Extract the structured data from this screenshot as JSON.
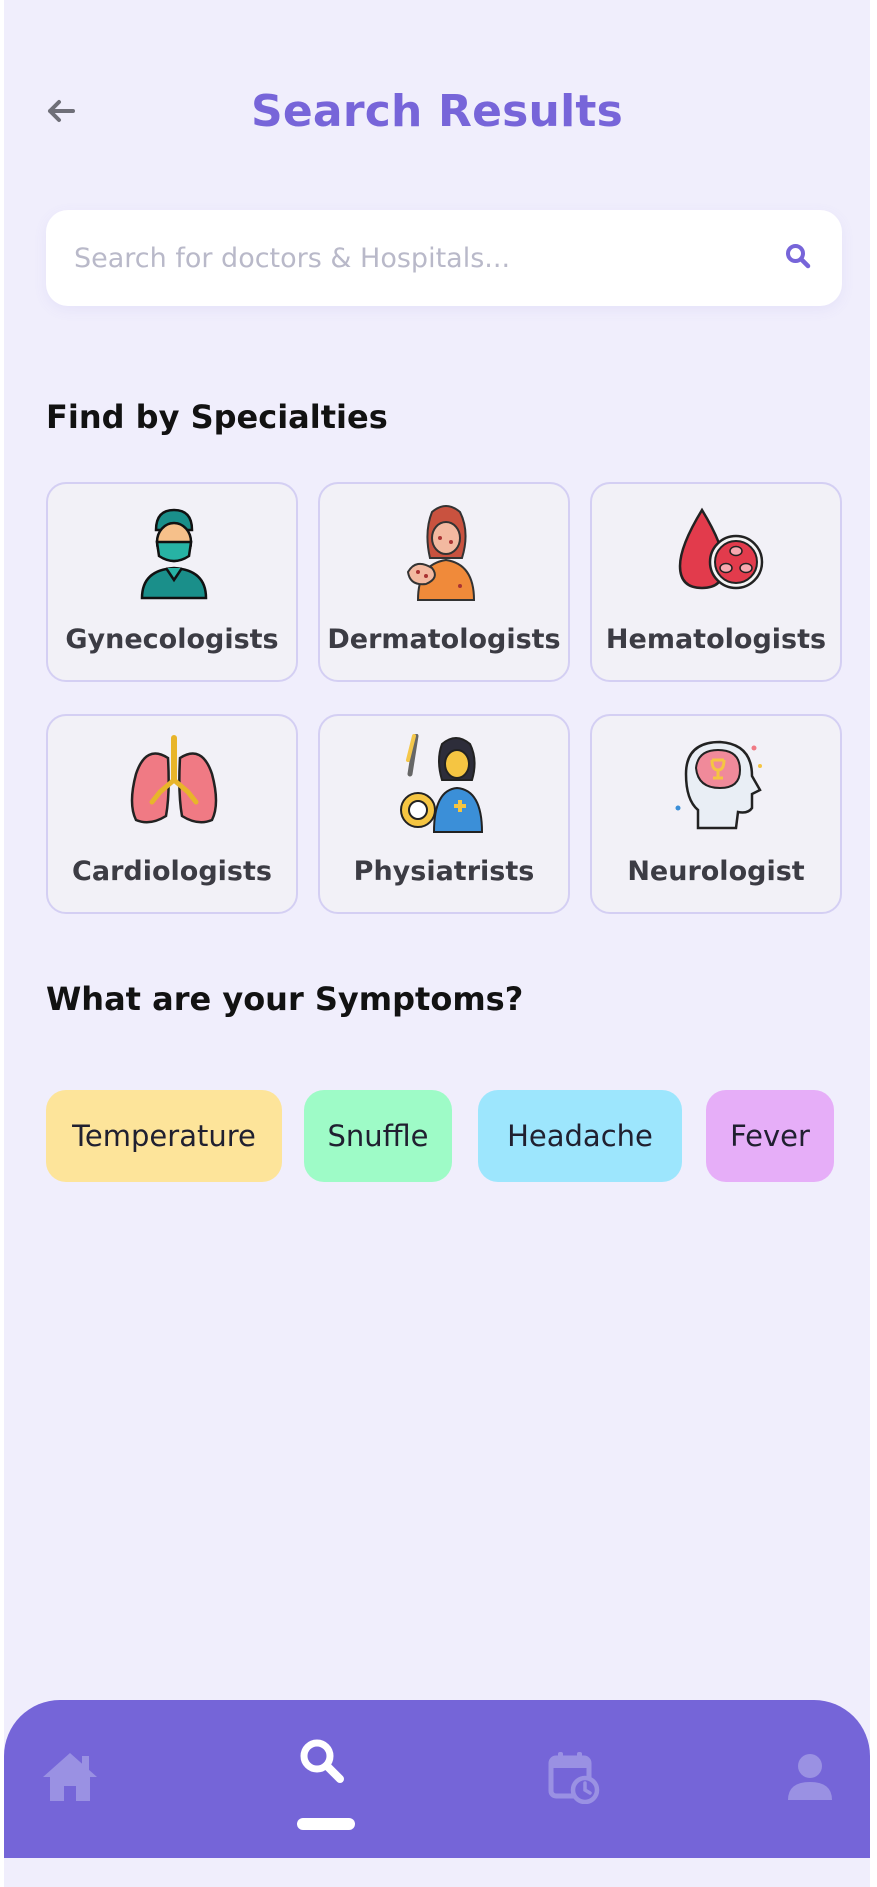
{
  "header": {
    "title": "Search Results",
    "back_icon": "arrow-left-icon"
  },
  "search": {
    "placeholder": "Search for doctors & Hospitals...",
    "icon": "search-icon"
  },
  "specialties": {
    "title": "Find by Specialties",
    "items": [
      {
        "label": "Gynecologists",
        "icon": "surgeon-icon"
      },
      {
        "label": "Dermatologists",
        "icon": "skin-condition-icon"
      },
      {
        "label": "Hematologists",
        "icon": "blood-drop-icon"
      },
      {
        "label": "Cardiologists",
        "icon": "lungs-icon"
      },
      {
        "label": "Physiatrists",
        "icon": "physiatrist-icon"
      },
      {
        "label": "Neurologist",
        "icon": "brain-head-icon"
      }
    ]
  },
  "symptoms": {
    "title": "What are your Symptoms?",
    "items": [
      {
        "label": "Temperature",
        "color": "#fde49a"
      },
      {
        "label": "Snuffle",
        "color": "#9efbc7"
      },
      {
        "label": "Headache",
        "color": "#9de6fd"
      },
      {
        "label": "Fever",
        "color": "#e6aef8"
      }
    ]
  },
  "colors": {
    "accent": "#7765d9",
    "nav_bg": "#7565d8",
    "screen_bg": "#f0eefc"
  },
  "bottom_nav": {
    "items": [
      {
        "icon": "home-icon",
        "active": false
      },
      {
        "icon": "search-icon",
        "active": true
      },
      {
        "icon": "calendar-clock-icon",
        "active": false
      },
      {
        "icon": "user-icon",
        "active": false
      }
    ]
  }
}
